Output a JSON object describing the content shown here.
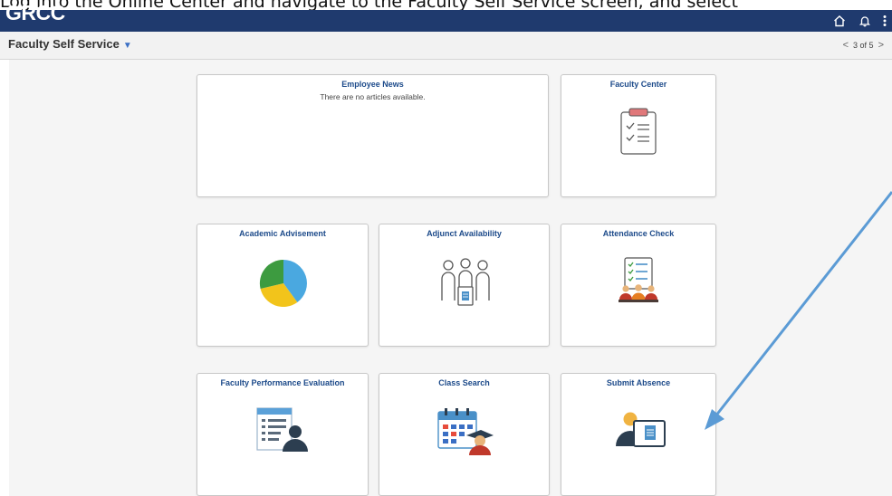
{
  "caption": "Log into the Online Center and navigate to the Faculty Self Service screen, and select",
  "header": {
    "logo": "GRCC",
    "icons": [
      "home-icon",
      "bell-icon",
      "menu-icon"
    ]
  },
  "subheader": {
    "title": "Faculty Self Service",
    "pager": "3 of 5"
  },
  "tiles": [
    {
      "title": "Employee News",
      "subtitle": "There are no articles available."
    },
    {
      "title": "Faculty Center",
      "icon": "clipboard-checklist-icon"
    },
    {
      "title": "Academic Advisement",
      "icon": "pie-chart-icon"
    },
    {
      "title": "Adjunct Availability",
      "icon": "people-document-icon"
    },
    {
      "title": "Attendance Check",
      "icon": "attendance-list-icon"
    },
    {
      "title": "Faculty Performance Evaluation",
      "icon": "evaluation-person-icon"
    },
    {
      "title": "Class Search",
      "icon": "calendar-student-icon"
    },
    {
      "title": "Submit Absence",
      "icon": "person-monitor-icon"
    }
  ],
  "colors": {
    "header": "#1f3a6e",
    "tile_title": "#1c4a8a",
    "arrow": "#5b9bd5"
  }
}
